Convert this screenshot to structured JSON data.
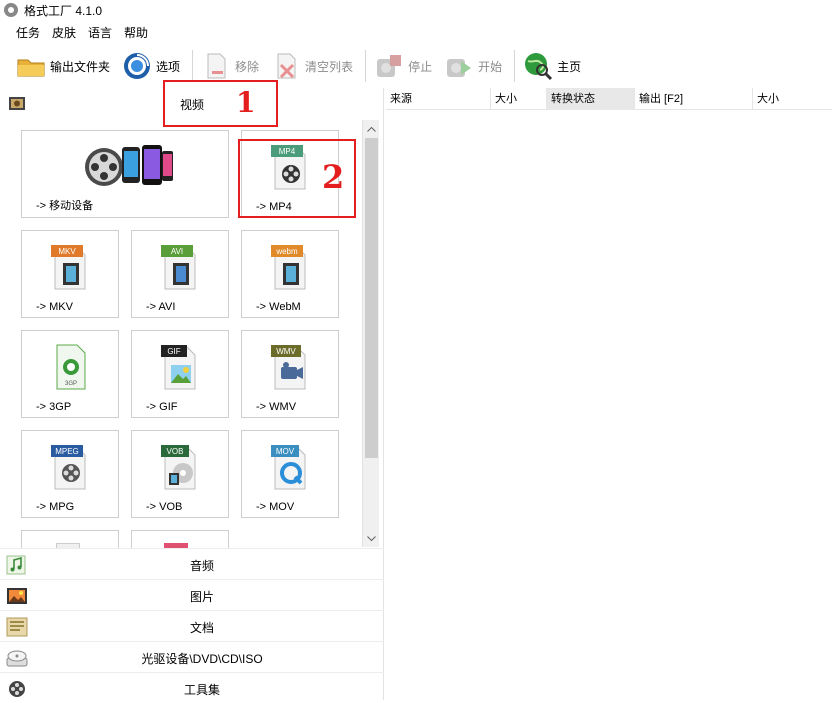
{
  "window": {
    "title": "格式工厂 4.1.0"
  },
  "menu": [
    "任务",
    "皮肤",
    "语言",
    "帮助"
  ],
  "toolbar": {
    "output_folder": "输出文件夹",
    "options": "选项",
    "remove": "移除",
    "clear_list": "清空列表",
    "stop": "停止",
    "start": "开始",
    "home": "主页"
  },
  "category_header": {
    "title": "视频"
  },
  "annotations": {
    "num1": "1",
    "num2": "2"
  },
  "tiles": [
    {
      "label": "-> 移动设备",
      "badge": ""
    },
    {
      "label": "-> MP4",
      "badge": "MP4"
    },
    {
      "label": "-> MKV",
      "badge": "MKV"
    },
    {
      "label": "-> AVI",
      "badge": "AVI"
    },
    {
      "label": "-> WebM",
      "badge": "webm"
    },
    {
      "label": "-> 3GP",
      "badge": "3GP"
    },
    {
      "label": "-> GIF",
      "badge": "GIF"
    },
    {
      "label": "-> WMV",
      "badge": "WMV"
    },
    {
      "label": "-> MPG",
      "badge": "MPEG"
    },
    {
      "label": "-> VOB",
      "badge": "VOB"
    },
    {
      "label": "-> MOV",
      "badge": "MOV"
    }
  ],
  "categories": [
    "音频",
    "图片",
    "文档",
    "光驱设备\\DVD\\CD\\ISO",
    "工具集"
  ],
  "table": {
    "headers": [
      "来源",
      "大小",
      "转换状态",
      "输出 [F2]",
      "大小"
    ]
  },
  "colors": {
    "highlight": "#e41e1e",
    "badge_mp4": "#4a9c7a",
    "badge_mkv": "#e07a2a",
    "badge_avi": "#5a9e3a",
    "badge_webm": "#e08a2a",
    "badge_gif": "#222222",
    "badge_wmv": "#6b6b2a",
    "badge_mpeg": "#2a5aa0",
    "badge_vob": "#2a6a3a",
    "badge_mov": "#3a8ec0"
  }
}
